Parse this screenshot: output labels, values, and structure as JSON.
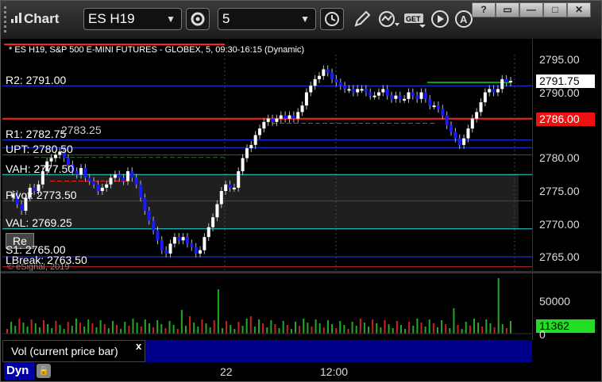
{
  "window": {
    "title": "Chart",
    "symbol": "ES H19",
    "interval": "5",
    "controls": {
      "help": "?",
      "restore": "▭",
      "minimize": "—",
      "maximize": "□",
      "close": "✕"
    }
  },
  "toolbar_icons": [
    "gear-icon",
    "clock-icon",
    "pencil-icon",
    "chart-studies-icon",
    "get-icon",
    "play-icon",
    "a-icon"
  ],
  "chart": {
    "header": "* ES H19, S&P 500 E-MINI FUTURES - GLOBEX, 5, 09:30-16:15 (Dynamic)",
    "watermark": "© eSignal, 2019",
    "price_ticks": [
      "2795.00",
      "2790.00",
      "2785.00",
      "2780.00",
      "2775.00",
      "2770.00",
      "2765.00"
    ],
    "last_price": "2791.75",
    "red_tag": "2786.00",
    "levels": [
      {
        "label": "R2: 2791.00"
      },
      {
        "label": "R1: 2782.75"
      },
      {
        "label": "UPT: 2780.50"
      },
      {
        "label": "VAH: 2777.50"
      },
      {
        "label": "Pivot: 2773.50"
      },
      {
        "label": "VAL: 2769.25"
      },
      {
        "label": "S1: 2765.00"
      },
      {
        "label": "LBreak: 2763.50"
      }
    ],
    "overlap_label": "2783.25",
    "button_label": "Re",
    "colors": {
      "up": "#ffffff",
      "down": "#1a1aff",
      "green": "#00ff00",
      "red": "#ff2020",
      "blue_line": "#2233ff",
      "cyan_line": "#22dddd"
    }
  },
  "volume": {
    "ticks": [
      "50000",
      "0"
    ],
    "last_volume": "11362",
    "study_label": "Vol (current price bar)",
    "close_label": "x"
  },
  "time_axis": {
    "labels": [
      "22",
      "12:00"
    ],
    "mode_label": "Dyn"
  }
}
